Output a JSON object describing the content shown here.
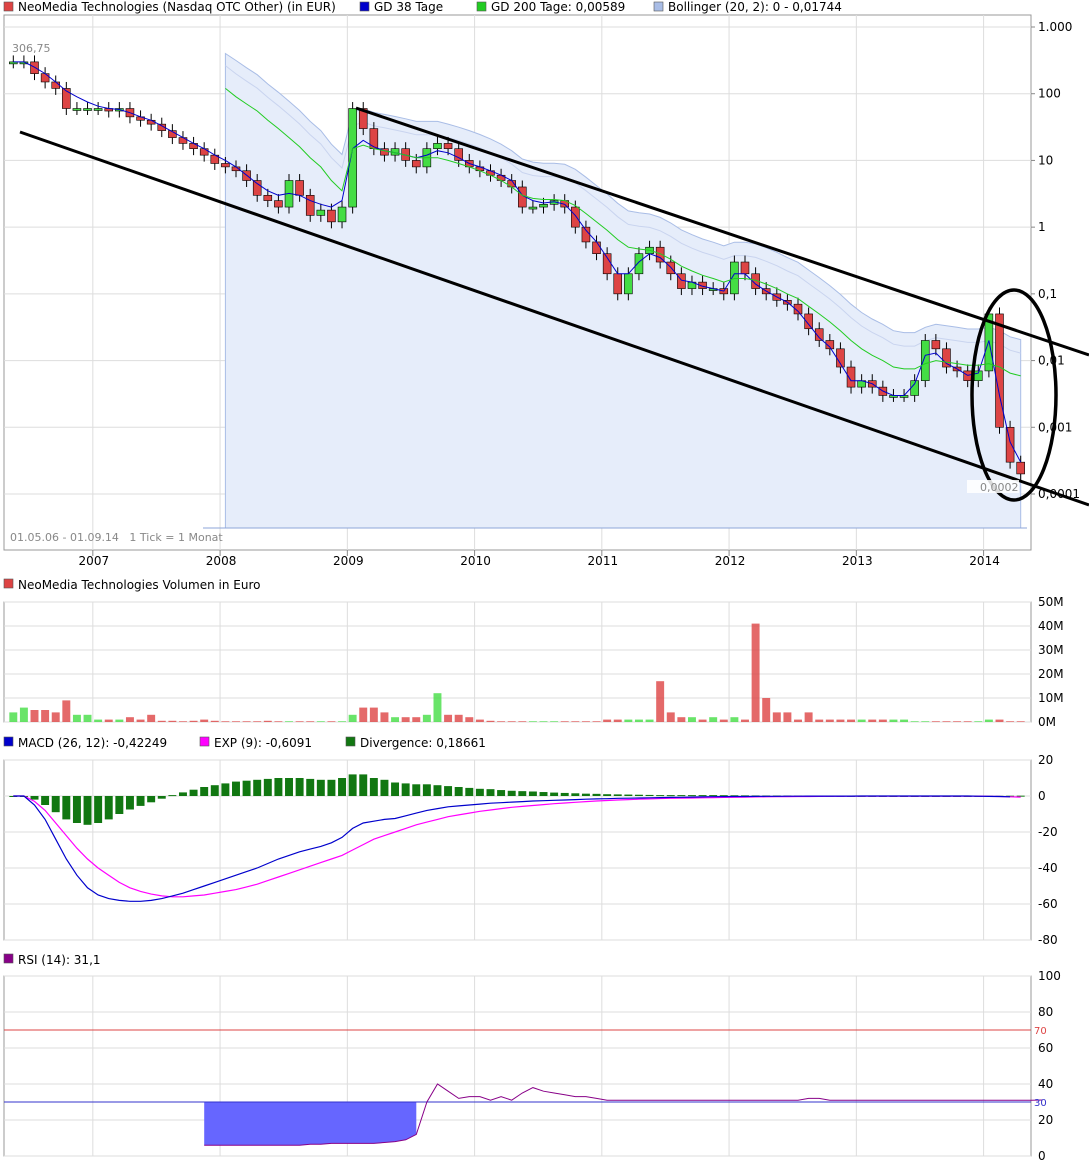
{
  "colors": {
    "up": "#44dd44",
    "down": "#dd4444",
    "wick": "#000000",
    "gd38": "#0000cc",
    "gd200": "#22cc22",
    "bollinger_fill": "#e6edfa",
    "bollinger_line": "#8ea6d8",
    "macd": "#0000cc",
    "exp": "#ff00ff",
    "divergence": "#117711",
    "rsi_line": "#880088",
    "rsi_fill": "#6666ff",
    "grid": "#dddddd",
    "axis_text": "#000000"
  },
  "price_panel": {
    "legend": [
      {
        "label": "NeoMedia Technologies (Nasdaq OTC Other) (in EUR)",
        "color": "#dd4444"
      },
      {
        "label": "GD 38 Tage",
        "color": "#0000cc"
      },
      {
        "label": "GD 200 Tage: 0,00589",
        "color": "#22cc22"
      },
      {
        "label": "Bollinger (20, 2): 0 - 0,01744",
        "color": "#a9bde6"
      }
    ],
    "high_label": "306,75",
    "low_label": "0,0002",
    "period_label": "01.05.06 - 01.09.14   1 Tick = 1 Monat",
    "y_ticks": [
      "1.000",
      "100",
      "10",
      "1",
      "0,1",
      "0,01",
      "0,001",
      "0,0001"
    ],
    "x_ticks": [
      "2007",
      "2008",
      "2009",
      "2010",
      "2011",
      "2012",
      "2013",
      "2014"
    ]
  },
  "volume_panel": {
    "legend": "NeoMedia Technologies Volumen in Euro",
    "legend_color": "#dd4444",
    "y_ticks": [
      "50M",
      "40M",
      "30M",
      "20M",
      "10M",
      "0M"
    ]
  },
  "macd_panel": {
    "legend": [
      {
        "label": "MACD (26, 12): -0,42249",
        "color": "#0000cc"
      },
      {
        "label": "EXP (9): -0,6091",
        "color": "#ff00ff"
      },
      {
        "label": "Divergence: 0,18661",
        "color": "#117711"
      }
    ],
    "y_ticks": [
      "20",
      "0",
      "-20",
      "-40",
      "-60",
      "-80"
    ]
  },
  "rsi_panel": {
    "legend": "RSI (14): 31,1",
    "legend_color": "#880088",
    "y_ticks": [
      "100",
      "80",
      "60",
      "40",
      "20",
      "0"
    ],
    "upper_label": "70",
    "lower_label": "30"
  },
  "chart_data": [
    {
      "type": "candlestick",
      "title": "NeoMedia Technologies (Nasdaq OTC Other) (in EUR)",
      "y_scale": "log",
      "ylim": [
        0.0001,
        1000
      ],
      "x_range": [
        "2006-05",
        "2014-09"
      ],
      "series": [
        {
          "name": "NeoMedia Technologies (Nasdaq OTC Other) (in EUR)",
          "close": [
            300,
            300,
            200,
            150,
            120,
            60,
            60,
            60,
            60,
            55,
            60,
            45,
            40,
            35,
            28,
            22,
            18,
            15,
            12,
            9,
            8,
            7,
            5,
            3,
            2.5,
            2,
            5,
            3,
            1.5,
            1.8,
            1.2,
            2,
            60,
            30,
            15,
            12,
            15,
            10,
            8,
            15,
            18,
            15,
            10,
            8,
            7,
            6,
            5,
            4,
            2,
            2,
            2.2,
            2.5,
            2,
            1,
            0.6,
            0.4,
            0.2,
            0.1,
            0.2,
            0.4,
            0.5,
            0.3,
            0.2,
            0.12,
            0.15,
            0.12,
            0.12,
            0.1,
            0.3,
            0.2,
            0.12,
            0.1,
            0.08,
            0.07,
            0.05,
            0.03,
            0.02,
            0.015,
            0.008,
            0.004,
            0.005,
            0.004,
            0.003,
            0.003,
            0.003,
            0.005,
            0.02,
            0.015,
            0.008,
            0.007,
            0.005,
            0.007,
            0.05,
            0.001,
            0.0003,
            0.0002
          ]
        },
        {
          "name": "GD 38 Tage",
          "values": [
            300,
            300,
            250,
            200,
            150,
            110,
            90,
            75,
            65,
            60,
            58,
            52,
            45,
            40,
            33,
            27,
            22,
            18,
            15,
            12,
            10,
            8,
            6,
            4.5,
            3.5,
            3,
            3.2,
            3,
            2.5,
            2.2,
            2,
            2.5,
            15,
            20,
            16,
            14,
            13,
            12,
            11,
            12,
            14,
            13,
            11,
            9,
            8,
            7,
            6,
            5,
            3,
            2.5,
            2.3,
            2.4,
            2.2,
            1.5,
            0.9,
            0.6,
            0.35,
            0.2,
            0.2,
            0.3,
            0.4,
            0.35,
            0.25,
            0.16,
            0.15,
            0.13,
            0.12,
            0.11,
            0.2,
            0.2,
            0.14,
            0.11,
            0.09,
            0.075,
            0.055,
            0.035,
            0.022,
            0.016,
            0.009,
            0.005,
            0.005,
            0.0045,
            0.0035,
            0.003,
            0.003,
            0.0045,
            0.012,
            0.013,
            0.009,
            0.0075,
            0.006,
            0.0065,
            0.02,
            0.003,
            0.0006,
            0.0003
          ]
        },
        {
          "name": "GD 200 Tage",
          "values": [
            null,
            null,
            null,
            null,
            null,
            null,
            null,
            null,
            null,
            null,
            null,
            null,
            null,
            null,
            null,
            null,
            null,
            null,
            null,
            null,
            120,
            90,
            70,
            55,
            40,
            30,
            22,
            16,
            11,
            8,
            5,
            3.5,
            15,
            17,
            15,
            14,
            13,
            12,
            11,
            11,
            11,
            10,
            9,
            8,
            7,
            6,
            5,
            4,
            3,
            2.7,
            2.6,
            2.6,
            2.5,
            2.1,
            1.6,
            1.2,
            0.9,
            0.65,
            0.5,
            0.47,
            0.45,
            0.4,
            0.33,
            0.26,
            0.22,
            0.19,
            0.17,
            0.15,
            0.17,
            0.17,
            0.16,
            0.14,
            0.12,
            0.1,
            0.085,
            0.065,
            0.05,
            0.038,
            0.028,
            0.02,
            0.015,
            0.012,
            0.01,
            0.008,
            0.0075,
            0.0075,
            0.009,
            0.01,
            0.0095,
            0.009,
            0.0085,
            0.0085,
            0.009,
            0.008,
            0.0065,
            0.00589
          ]
        }
      ]
    },
    {
      "type": "bar",
      "title": "NeoMedia Technologies Volumen in Euro",
      "ylim": [
        0,
        50
      ],
      "unit": "M",
      "values": [
        4,
        6,
        5,
        5,
        4,
        9,
        3,
        3,
        1,
        1,
        1,
        2,
        1,
        3,
        0.5,
        0.5,
        0.3,
        0.5,
        1,
        0.5,
        0.3,
        0.3,
        0.3,
        0.3,
        0.5,
        0.3,
        0.3,
        0.3,
        0.3,
        0.3,
        0.3,
        0.3,
        3,
        6,
        6,
        4,
        2,
        2,
        2,
        3,
        12,
        3,
        3,
        2,
        1,
        0.5,
        0.3,
        0.3,
        0.3,
        0.3,
        0.3,
        0.3,
        0.3,
        0.3,
        0.3,
        0.3,
        1,
        1,
        1,
        1,
        1,
        17,
        4,
        2,
        2,
        1,
        2,
        1,
        2,
        1,
        41,
        10,
        4,
        4,
        1,
        4,
        1,
        1,
        1,
        1,
        1,
        1,
        1,
        1,
        1,
        0.3,
        0.3,
        0.3,
        0.3,
        0.3,
        0.3,
        0.3,
        1,
        1,
        0.3,
        0.3
      ]
    },
    {
      "type": "line",
      "title": "MACD",
      "ylim": [
        -80,
        20
      ],
      "series": [
        {
          "name": "MACD (26, 12)",
          "values": [
            0,
            0,
            -5,
            -13,
            -24,
            -35,
            -44,
            -51,
            -55,
            -57,
            -58,
            -58.5,
            -58.5,
            -58,
            -57,
            -55.5,
            -54,
            -52,
            -50,
            -48,
            -46,
            -44,
            -42,
            -40,
            -37.5,
            -35,
            -33,
            -31,
            -29.5,
            -28,
            -26,
            -23,
            -18,
            -15,
            -14,
            -13,
            -12.5,
            -11,
            -9.5,
            -8,
            -7,
            -6,
            -5.5,
            -5,
            -4.5,
            -4,
            -3.7,
            -3.4,
            -3.1,
            -2.8,
            -2.6,
            -2.4,
            -2.2,
            -2,
            -1.8,
            -1.6,
            -1.5,
            -1.3,
            -1.2,
            -1.1,
            -1,
            -0.9,
            -0.8,
            -0.7,
            -0.6,
            -0.5,
            -0.4,
            -0.35,
            -0.3,
            -0.25,
            -0.2,
            -0.18,
            -0.15,
            -0.12,
            -0.1,
            -0.08,
            -0.06,
            -0.05,
            -0.04,
            -0.03,
            -0.02,
            -0.015,
            -0.01,
            -0.01,
            -0.01,
            -0.01,
            -0.01,
            -0.01,
            -0.01,
            -0.01,
            -0.01,
            -0.1,
            -0.2,
            -0.3,
            -0.42249
          ]
        },
        {
          "name": "EXP (9)",
          "values": [
            0,
            0,
            -3,
            -8,
            -15,
            -22,
            -29,
            -35,
            -40,
            -44,
            -48,
            -51,
            -53,
            -54.5,
            -55.5,
            -56,
            -56,
            -55.5,
            -55,
            -54,
            -53,
            -52,
            -50.5,
            -49,
            -47,
            -45,
            -43,
            -41,
            -39,
            -37,
            -35,
            -33,
            -30,
            -27,
            -24,
            -22,
            -20,
            -18,
            -16,
            -14.5,
            -13,
            -11.5,
            -10.5,
            -9.5,
            -8.5,
            -7.8,
            -7,
            -6.3,
            -5.8,
            -5.3,
            -4.8,
            -4.3,
            -3.9,
            -3.5,
            -3.1,
            -2.8,
            -2.5,
            -2.2,
            -2,
            -1.8,
            -1.6,
            -1.4,
            -1.3,
            -1.2,
            -1.1,
            -1,
            -0.9,
            -0.8,
            -0.7,
            -0.6,
            -0.5,
            -0.45,
            -0.4,
            -0.35,
            -0.3,
            -0.25,
            -0.2,
            -0.18,
            -0.15,
            -0.12,
            -0.1,
            -0.08,
            -0.06,
            -0.05,
            -0.04,
            -0.04,
            -0.04,
            -0.04,
            -0.04,
            -0.04,
            -0.04,
            -0.04,
            -0.2,
            -0.3,
            -0.45,
            -0.6091
          ]
        },
        {
          "name": "Divergence",
          "values": [
            0,
            0,
            -2,
            -5,
            -9,
            -13,
            -15,
            -16,
            -15,
            -13,
            -10,
            -7.5,
            -5.5,
            -3.5,
            -1.5,
            0.5,
            2,
            3.5,
            5,
            6,
            7,
            8,
            8.5,
            9,
            9.5,
            10,
            10,
            10,
            9.5,
            9,
            9,
            10,
            12,
            12,
            10,
            9,
            7.5,
            7,
            6.5,
            6.5,
            6,
            5.5,
            5,
            4.5,
            4,
            3.8,
            3.3,
            2.9,
            2.7,
            2.5,
            2.2,
            1.9,
            1.7,
            1.5,
            1.3,
            1.2,
            1,
            0.9,
            0.8,
            0.7,
            0.6,
            0.5,
            0.5,
            0.5,
            0.5,
            0.5,
            0.5,
            0.45,
            0.4,
            0.35,
            0.3,
            0.27,
            0.25,
            0.23,
            0.2,
            0.17,
            0.14,
            0.13,
            0.11,
            0.09,
            0.08,
            0.065,
            0.05,
            0.04,
            0.03,
            0.03,
            0.03,
            0.03,
            0.03,
            0.03,
            0.03,
            0.03,
            0.1,
            0.1,
            0.15,
            0.18661
          ]
        }
      ]
    },
    {
      "type": "line",
      "title": "RSI (14)",
      "ylim": [
        0,
        100
      ],
      "series": [
        {
          "name": "RSI (14)",
          "values": [
            null,
            null,
            null,
            null,
            null,
            null,
            null,
            null,
            null,
            null,
            null,
            null,
            null,
            null,
            null,
            null,
            null,
            null,
            6,
            6,
            6,
            6,
            6,
            6,
            6,
            6,
            6,
            6,
            6.5,
            6.5,
            7,
            7,
            7,
            7,
            7,
            7.5,
            8,
            9,
            12,
            30,
            40,
            36,
            32,
            33,
            33,
            31,
            33,
            31,
            35,
            38,
            36,
            35,
            34,
            33,
            33,
            32,
            31,
            31,
            31,
            31,
            31,
            31,
            31,
            31,
            31,
            31,
            31,
            31,
            31,
            31,
            31,
            31,
            31,
            31,
            31,
            32,
            32,
            31,
            31,
            31,
            31,
            31,
            31,
            31,
            31,
            31,
            31,
            31,
            31,
            31,
            31,
            31,
            31,
            31,
            31,
            31,
            31,
            31.1
          ]
        }
      ],
      "reference_lines": [
        70,
        30
      ]
    }
  ]
}
